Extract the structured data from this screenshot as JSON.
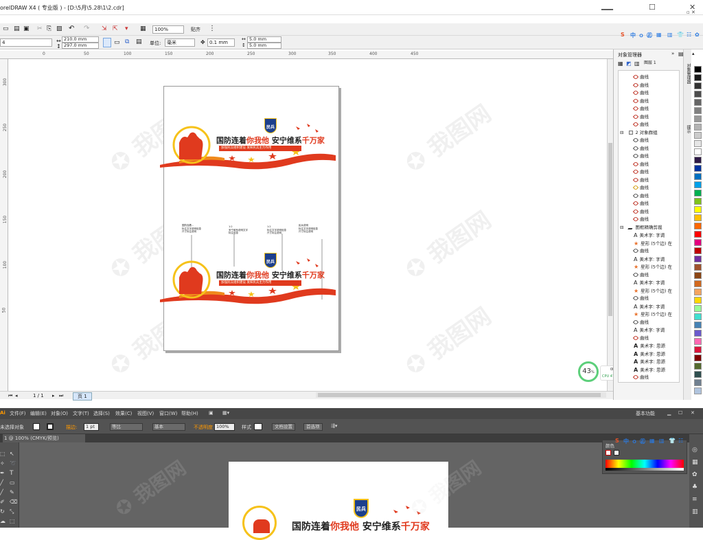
{
  "corel": {
    "title": "orelDRAW X4 ( 专业版 ) - [D:\\5月\\5.28\\1\\2.cdr]",
    "zoom": "100%",
    "snap": "贴齐",
    "page_width": "210.0 mm",
    "page_height": "297.0 mm",
    "units_label": "单位:",
    "units_value": "毫米",
    "nudge": "0.1 mm",
    "dup_x": "5.0 mm",
    "dup_y": "5.0 mm",
    "ruler_h": [
      "0",
      "50",
      "100",
      "150",
      "200",
      "250",
      "300",
      "350",
      "400",
      "450"
    ],
    "ruler_v": [
      "300",
      "250",
      "200",
      "150",
      "100",
      "50"
    ],
    "page_counter": "1 / 1",
    "page_tab": "页 1",
    "perf": {
      "percent": "43",
      "percent_unit": "%",
      "net": "0K/s",
      "cpu": "CPU 47℃"
    }
  },
  "design": {
    "title_pre": "国防连着",
    "title_hi": "你我他",
    "title_post": " 安宁维系",
    "title_hi2": "千万家",
    "badge": "民兵",
    "subtitle": "加强民兵组织建设  发挥民兵主力作用",
    "dim_blocks": [
      {
        "l1": "国防连着...",
        "l2": "标注文字说明信息",
        "l3": "尺寸标注说明"
      },
      {
        "l1": "1:2",
        "l2": "安宁维系说明文字",
        "l3": "标注信息"
      },
      {
        "l1": "1:2",
        "l2": "标注文字说明信息",
        "l3": "尺寸标注说明"
      },
      {
        "l1": "民兵说明",
        "l2": "标注文字说明信息",
        "l3": "尺寸标注说明"
      }
    ]
  },
  "objects": {
    "title": "对象管理器",
    "layer_header": "图层 1",
    "rows": [
      {
        "label": "曲线",
        "icon": "curve-red",
        "indent": 2
      },
      {
        "label": "曲线",
        "icon": "curve-red",
        "indent": 2
      },
      {
        "label": "曲线",
        "icon": "curve-red",
        "indent": 2
      },
      {
        "label": "曲线",
        "icon": "curve-red",
        "indent": 2
      },
      {
        "label": "曲线",
        "icon": "curve-red",
        "indent": 2
      },
      {
        "label": "曲线",
        "icon": "curve-red",
        "indent": 2
      },
      {
        "label": "曲线",
        "icon": "curve-red",
        "indent": 2
      },
      {
        "label": "2 对象群组",
        "icon": "group",
        "indent": 1
      },
      {
        "label": "曲线",
        "icon": "curve-outline",
        "indent": 2
      },
      {
        "label": "曲线",
        "icon": "curve-outline",
        "indent": 2
      },
      {
        "label": "曲线",
        "icon": "curve-outline",
        "indent": 2
      },
      {
        "label": "曲线",
        "icon": "curve-red",
        "indent": 2
      },
      {
        "label": "曲线",
        "icon": "curve-red",
        "indent": 2
      },
      {
        "label": "曲线",
        "icon": "curve-red",
        "indent": 2
      },
      {
        "label": "曲线",
        "icon": "curve-gold",
        "indent": 2
      },
      {
        "label": "曲线",
        "icon": "curve-outline",
        "indent": 2
      },
      {
        "label": "曲线",
        "icon": "curve-red",
        "indent": 2
      },
      {
        "label": "曲线",
        "icon": "curve-red",
        "indent": 2
      },
      {
        "label": "曲线",
        "icon": "curve-red",
        "indent": 2
      },
      {
        "label": "图框精确剪裁",
        "icon": "powerclip",
        "indent": 1
      },
      {
        "label": "美术字: 字调",
        "icon": "text",
        "indent": 2
      },
      {
        "label": "星形 (5个边) 在",
        "icon": "star",
        "indent": 2
      },
      {
        "label": "曲线",
        "icon": "curve-outline",
        "indent": 2
      },
      {
        "label": "美术字: 字调",
        "icon": "text",
        "indent": 2
      },
      {
        "label": "星形 (5个边) 在",
        "icon": "star",
        "indent": 2
      },
      {
        "label": "曲线",
        "icon": "curve-outline",
        "indent": 2
      },
      {
        "label": "美术字: 字调",
        "icon": "text",
        "indent": 2
      },
      {
        "label": "星形 (5个边) 在",
        "icon": "star",
        "indent": 2
      },
      {
        "label": "曲线",
        "icon": "curve-outline",
        "indent": 2
      },
      {
        "label": "美术字: 字调",
        "icon": "text",
        "indent": 2
      },
      {
        "label": "星形 (5个边) 在",
        "icon": "star",
        "indent": 2
      },
      {
        "label": "曲线",
        "icon": "curve-outline",
        "indent": 2
      },
      {
        "label": "美术字: 字调",
        "icon": "text",
        "indent": 2
      },
      {
        "label": "曲线",
        "icon": "curve-red",
        "indent": 2
      },
      {
        "label": "美术字: 思源",
        "icon": "text-bold",
        "indent": 2
      },
      {
        "label": "美术字: 思源",
        "icon": "text-bold",
        "indent": 2
      },
      {
        "label": "美术字: 思源",
        "icon": "text-bold",
        "indent": 2
      },
      {
        "label": "美术字: 思源",
        "icon": "text-bold",
        "indent": 2
      },
      {
        "label": "曲线",
        "icon": "curve-red",
        "indent": 2
      }
    ]
  },
  "palette": [
    "#000000",
    "#1a1a1a",
    "#333333",
    "#4d4d4d",
    "#666666",
    "#808080",
    "#999999",
    "#b3b3b3",
    "#cccccc",
    "#e6e6e6",
    "#ffffff",
    "#2e1a47",
    "#0033a0",
    "#0070c0",
    "#00a0e9",
    "#00b050",
    "#7fc31c",
    "#ffff00",
    "#ffc000",
    "#ff6600",
    "#ff0000",
    "#e4007f",
    "#c00000",
    "#7030a0",
    "#a0522d",
    "#8b4513",
    "#d2691e",
    "#f4a460",
    "#ffd700",
    "#98fb98",
    "#40e0d0",
    "#4682b4",
    "#6a5acd",
    "#ff69b4",
    "#dc143c",
    "#800000",
    "#556b2f",
    "#2f4f4f",
    "#708090",
    "#b0c4de"
  ],
  "ime": [
    "中",
    "ｏ",
    "㊣",
    "▦",
    "▥",
    "☷",
    "👕",
    "✿"
  ],
  "ai": {
    "menus": [
      "文件(F)",
      "编辑(E)",
      "对象(O)",
      "文字(T)",
      "选择(S)",
      "效果(C)",
      "视图(V)",
      "窗口(W)",
      "帮助(H)"
    ],
    "workspace": "基本功能",
    "no_selection": "未选择对象",
    "stroke_label": "描边:",
    "stroke_value": "1 pt",
    "brush_label": "等比",
    "basic_label": "基本",
    "opacity_label": "不透明度",
    "opacity_value": "100%",
    "style_label": "样式",
    "doc_setup": "文档设置",
    "prefs": "首选项",
    "doc_tab": "1 @ 100% (CMYK/预览)",
    "color_panel": "颜色",
    "art_title_pre": "国防连着",
    "art_title_hi": "你我他",
    "art_title_post": " 安宁维系",
    "art_title_hi2": "千万家",
    "art_badge": "民兵"
  },
  "colors": {
    "brand_red": "#e03a1e",
    "orange": "#f08a1c",
    "gold": "#f6c21a",
    "navy": "#1c3f8c"
  }
}
